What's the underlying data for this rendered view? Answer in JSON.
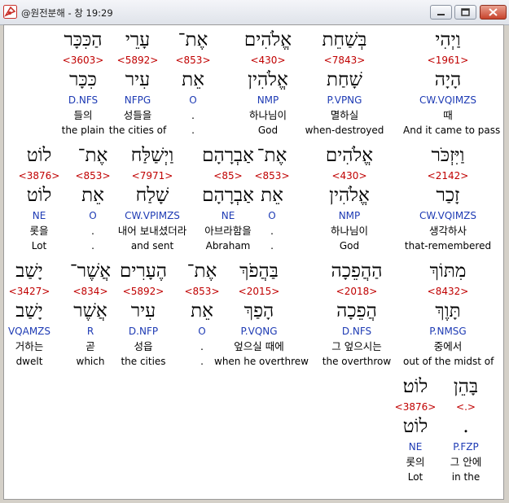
{
  "window": {
    "title": "@원전분해 - 창 19:29"
  },
  "colors": {
    "strongs": "#c00000",
    "morphology": "#1e3bb4",
    "text": "#000000",
    "background": "#ffffff"
  },
  "icons": {
    "app": "app-logo-icon",
    "minimize": "minimize-icon",
    "maximize": "maximize-icon",
    "close": "close-icon"
  },
  "verse": {
    "rows": [
      {
        "words": [
          {
            "heb": "וַיְהִי",
            "strong": "<1961>",
            "lemma": "הָיָה",
            "morph": "CW.VQIMZS",
            "kor": "때",
            "eng": "And it came to pass"
          },
          {
            "heb": "בְּשַׁחֵת",
            "strong": "<7843>",
            "lemma": "שָׁחַת",
            "morph": "P.VPNG",
            "kor": "멸하실",
            "eng": "when-destroyed"
          },
          {
            "heb": "אֱלֹהִים",
            "strong": "<430>",
            "lemma": "אֱלֹהִין",
            "morph": "NMP",
            "kor": "하나님이",
            "eng": "God"
          },
          {
            "heb": "אֶת־",
            "strong": "<853>",
            "lemma": "אֵת",
            "morph": "O",
            "kor": ".",
            "eng": "."
          },
          {
            "heb": "עָרֵי",
            "strong": "<5892>",
            "lemma": "עִיר",
            "morph": "NFPG",
            "kor": "성들을",
            "eng": "the cities of"
          },
          {
            "heb": "הַכִּכָּר",
            "strong": "<3603>",
            "lemma": "כִּכָּר",
            "morph": "D.NFS",
            "kor": "들의",
            "eng": "the plain"
          }
        ]
      },
      {
        "words": [
          {
            "heb": "וַיִּזְכֹּר",
            "strong": "<2142>",
            "lemma": "זָכַר",
            "morph": "CW.VQIMZS",
            "kor": "생각하사",
            "eng": "that-remembered"
          },
          {
            "heb": "אֱלֹהִים",
            "strong": "<430>",
            "lemma": "אֱלֹהִין",
            "morph": "NMP",
            "kor": "하나님이",
            "eng": "God"
          },
          {
            "heb": "אֶת־",
            "strong": "<853>",
            "lemma": "אֵת",
            "morph": "O",
            "kor": ".",
            "eng": "."
          },
          {
            "heb": "אַבְרָהָם",
            "strong": "<85>",
            "lemma": "אַבְרָהָם",
            "morph": "NE",
            "kor": "아브라함을",
            "eng": "Abraham"
          },
          {
            "heb": "וַיְשַׁלַּח",
            "strong": "<7971>",
            "lemma": "שָׁלַח",
            "morph": "CW.VPIMZS",
            "kor": "내어 보내셨더라",
            "eng": "and sent"
          },
          {
            "heb": "אֶת־",
            "strong": "<853>",
            "lemma": "אֵת",
            "morph": "O",
            "kor": ".",
            "eng": "."
          },
          {
            "heb": "לוֹט",
            "strong": "<3876>",
            "lemma": "לוֹט",
            "morph": "NE",
            "kor": "롯을",
            "eng": "Lot"
          }
        ]
      },
      {
        "words": [
          {
            "heb": "מִתּוֹךְ",
            "strong": "<8432>",
            "lemma": "תָּוֶךְ",
            "morph": "P.NMSG",
            "kor": "중에서",
            "eng": "out of the midst of"
          },
          {
            "heb": "הַהֲפֵכָה",
            "strong": "<2018>",
            "lemma": "הֲפֵכָה",
            "morph": "D.NFS",
            "kor": "그 엎으시는",
            "eng": "the overthrow"
          },
          {
            "heb": "בַּהֲפֹךְ",
            "strong": "<2015>",
            "lemma": "הָפַךְ",
            "morph": "P.VQNG",
            "kor": "엎으실 때에",
            "eng": "when he overthrew"
          },
          {
            "heb": "אֶת־",
            "strong": "<853>",
            "lemma": "אֵת",
            "morph": "O",
            "kor": ".",
            "eng": "."
          },
          {
            "heb": "הֶעָרִים",
            "strong": "<5892>",
            "lemma": "עִיר",
            "morph": "D.NFP",
            "kor": "성읍",
            "eng": "the cities"
          },
          {
            "heb": "אֲשֶׁר־",
            "strong": "<834>",
            "lemma": "אֲשֶׁר",
            "morph": "R",
            "kor": "곧",
            "eng": "which"
          },
          {
            "heb": "יָשַׁב",
            "strong": "<3427>",
            "lemma": "יָשַׁב",
            "morph": "VQAMZS",
            "kor": "거하는",
            "eng": "dwelt"
          }
        ]
      },
      {
        "words": [
          {
            "heb": "בָּהֵן",
            "strong": "<.>",
            "lemma": ".",
            "morph": "P.FZP",
            "kor": "그 안에",
            "eng": "in the"
          },
          {
            "heb": "לוֹט׃",
            "strong": "<3876>",
            "lemma": "לוֹט",
            "morph": "NE",
            "kor": "롯의",
            "eng": "Lot"
          }
        ]
      }
    ]
  }
}
